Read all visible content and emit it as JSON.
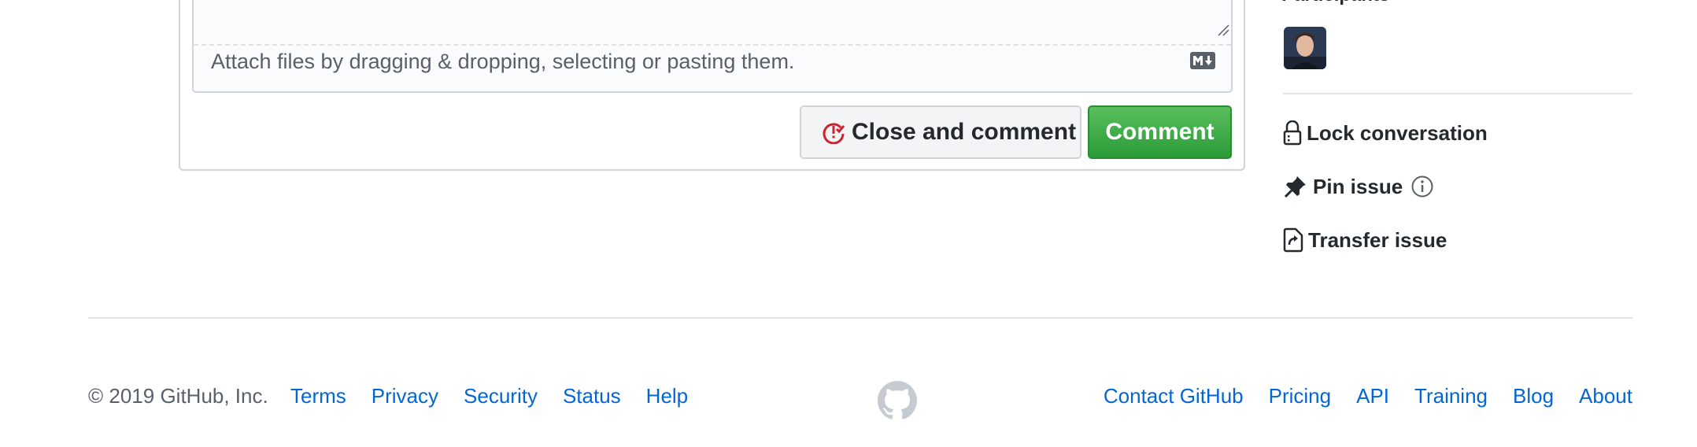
{
  "sidebar_top_label": "Participants",
  "editor": {
    "attach_text": "Attach files by dragging & dropping, selecting or pasting them.",
    "markdown_icon": "markdown-icon"
  },
  "buttons": {
    "close_and_comment": "Close and comment",
    "comment": "Comment"
  },
  "sidebar": {
    "lock": "Lock conversation",
    "pin": "Pin issue",
    "transfer": "Transfer issue"
  },
  "footer": {
    "copyright": "© 2019 GitHub, Inc.",
    "left_links": [
      "Terms",
      "Privacy",
      "Security",
      "Status",
      "Help"
    ],
    "right_links": [
      "Contact GitHub",
      "Pricing",
      "API",
      "Training",
      "Blog",
      "About"
    ]
  },
  "colors": {
    "link": "#0366d6",
    "comment_button": "#2ea44f",
    "close_icon": "#cb2431"
  }
}
